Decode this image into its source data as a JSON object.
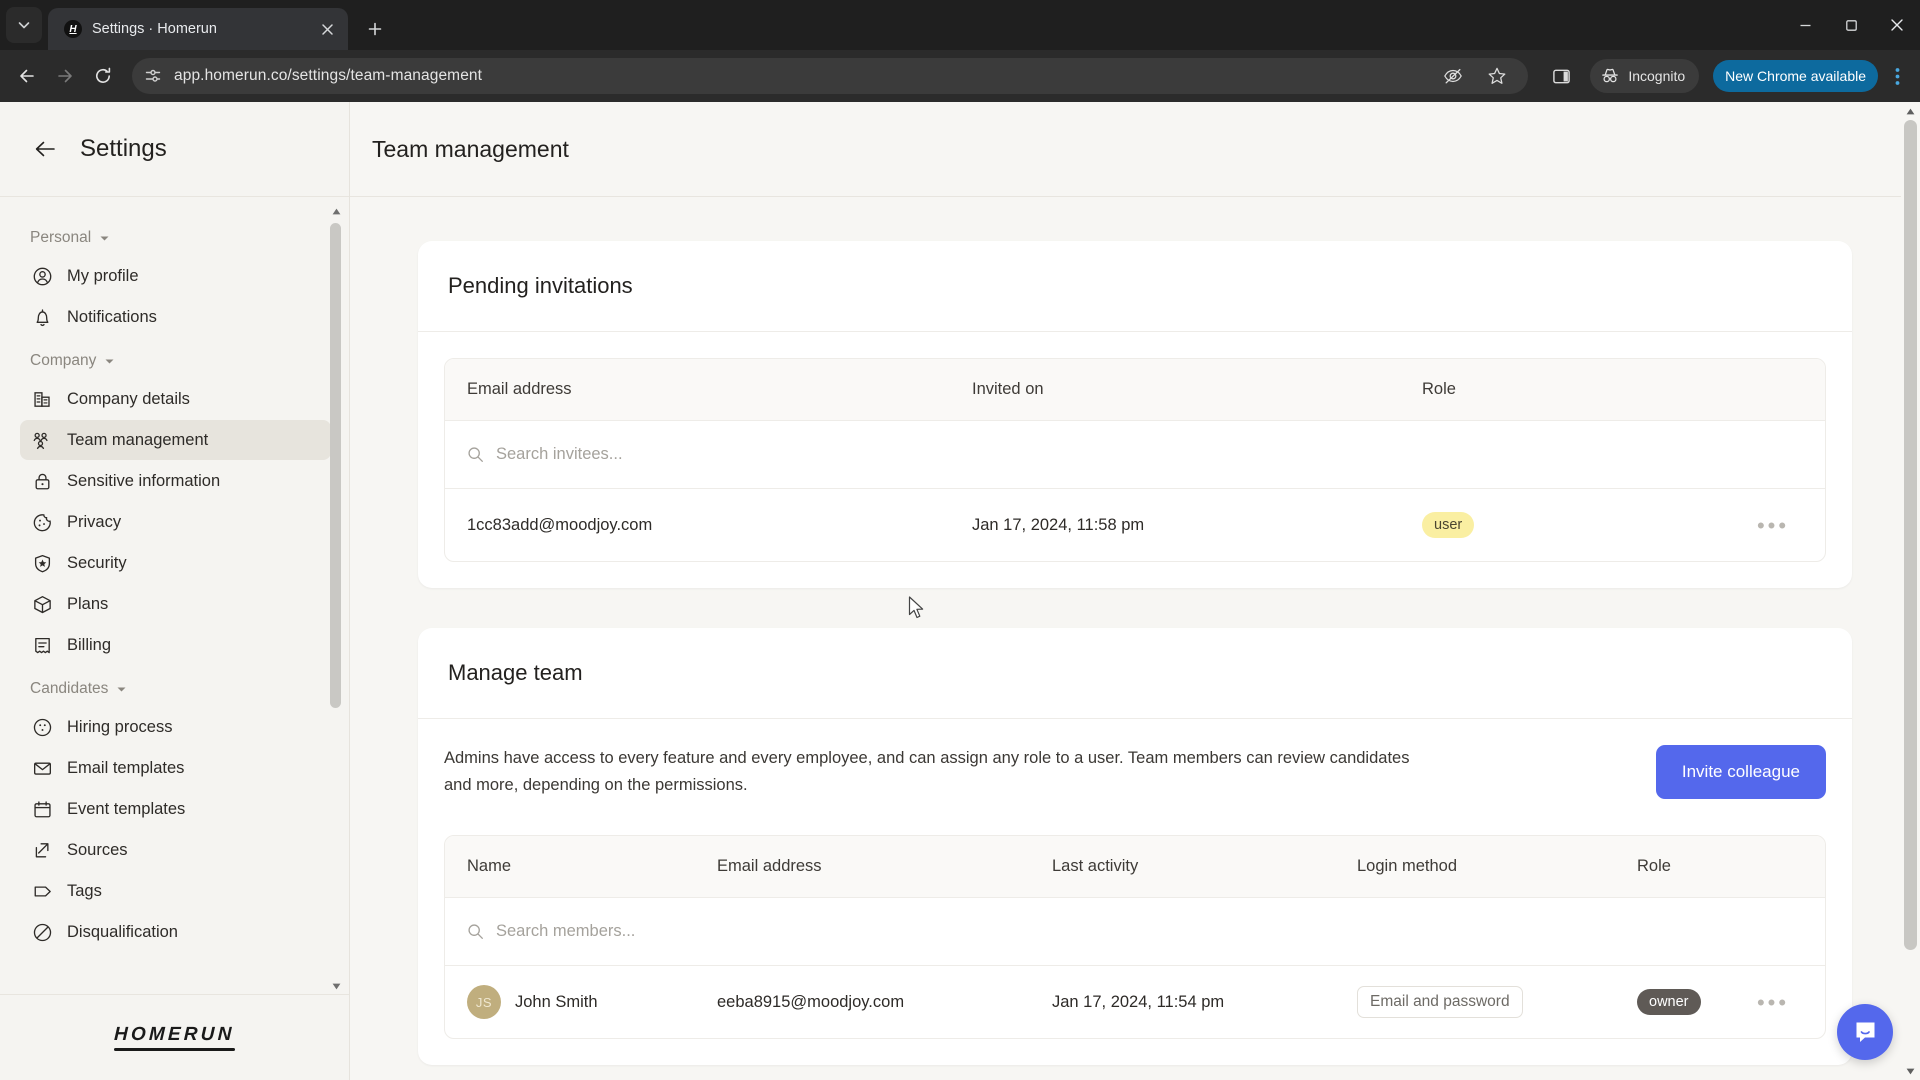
{
  "browser": {
    "tab": {
      "title": "Settings · Homerun",
      "favicon_letter": "H"
    },
    "new_tab_label": "+",
    "url": "app.homerun.co/settings/team-management",
    "incognito_label": "Incognito",
    "update_label": "New Chrome available",
    "icons": {
      "tab_search": "chevron-down-icon",
      "close_tab": "close-icon",
      "back": "back-arrow-icon",
      "forward": "forward-arrow-icon",
      "reload": "reload-icon",
      "site_info": "site-settings-icon",
      "third_party_cookies": "eye-off-icon",
      "bookmark": "star-icon",
      "side_panel": "side-panel-icon",
      "incognito": "incognito-icon",
      "menu": "kebab-menu-icon"
    }
  },
  "sidebar": {
    "title": "Settings",
    "groups": [
      {
        "label": "Personal",
        "items": [
          {
            "label": "My profile",
            "icon": "user-circle-icon",
            "active": false
          },
          {
            "label": "Notifications",
            "icon": "bell-icon",
            "active": false
          }
        ]
      },
      {
        "label": "Company",
        "items": [
          {
            "label": "Company details",
            "icon": "building-icon",
            "active": false
          },
          {
            "label": "Team management",
            "icon": "people-icon",
            "active": true
          },
          {
            "label": "Sensitive information",
            "icon": "lock-icon",
            "active": false
          },
          {
            "label": "Privacy",
            "icon": "cookie-icon",
            "active": false
          },
          {
            "label": "Security",
            "icon": "shield-star-icon",
            "active": false
          },
          {
            "label": "Plans",
            "icon": "box-icon",
            "active": false
          },
          {
            "label": "Billing",
            "icon": "receipt-icon",
            "active": false
          }
        ]
      },
      {
        "label": "Candidates",
        "items": [
          {
            "label": "Hiring process",
            "icon": "face-icon",
            "active": false
          },
          {
            "label": "Email templates",
            "icon": "envelope-icon",
            "active": false
          },
          {
            "label": "Event templates",
            "icon": "calendar-icon",
            "active": false
          },
          {
            "label": "Sources",
            "icon": "arrow-out-box-icon",
            "active": false
          },
          {
            "label": "Tags",
            "icon": "tag-icon",
            "active": false
          },
          {
            "label": "Disqualification",
            "icon": "no-entry-icon",
            "active": false
          }
        ]
      }
    ],
    "logo": "HOMERUN"
  },
  "main": {
    "page_title": "Team management",
    "pending": {
      "heading": "Pending invitations",
      "columns": [
        "Email address",
        "Invited on",
        "Role"
      ],
      "search_placeholder": "Search invitees...",
      "search_value": "",
      "rows": [
        {
          "email": "1cc83add@moodjoy.com",
          "invited_on": "Jan 17, 2024, 11:58 pm",
          "role": "user",
          "menu": "•••"
        }
      ]
    },
    "manage": {
      "heading": "Manage team",
      "description": "Admins have access to every feature and every employee, and can assign any role to a user. Team members can review candidates and more, depending on the permissions.",
      "invite_button": "Invite colleague",
      "columns": [
        "Name",
        "Email address",
        "Last activity",
        "Login method",
        "Role"
      ],
      "search_placeholder": "Search members...",
      "search_value": "",
      "rows": [
        {
          "initials": "JS",
          "name": "John Smith",
          "email": "eeba8915@moodjoy.com",
          "last_activity": "Jan 17, 2024, 11:54 pm",
          "login_method": "Email and password",
          "role": "owner",
          "menu": "•••"
        }
      ]
    }
  },
  "widgets": {
    "intercom": "chat-bubble-icon"
  },
  "colors": {
    "accent_blue": "#5468ec",
    "badge_user_bg": "#faefa2",
    "badge_owner_bg": "#5f5a56",
    "avatar_bg": "#c0ae7e",
    "app_bg": "#f7f6f3",
    "sidebar_bg": "#f5f4f1",
    "update_chip_bg": "#0d6a9e"
  }
}
